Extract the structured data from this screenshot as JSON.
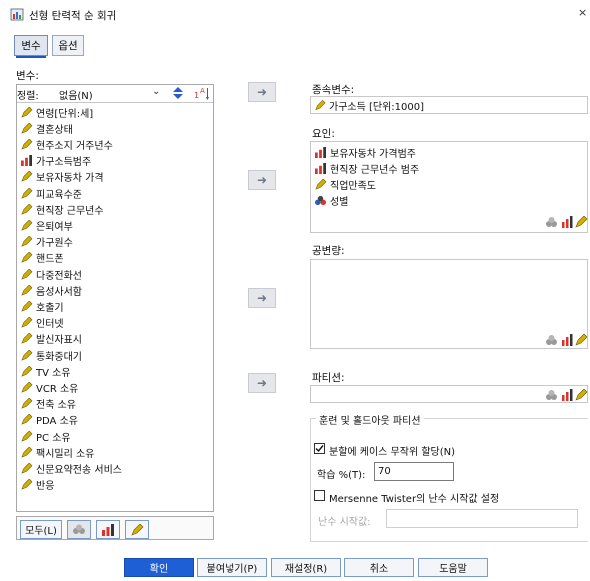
{
  "window": {
    "title": "선형 탄력적 순 회귀"
  },
  "tabs": [
    {
      "label": "변수"
    },
    {
      "label": "옵션"
    }
  ],
  "variables": {
    "label": "변수:",
    "sort": {
      "label": "정렬:",
      "value": "없음(N)"
    },
    "items": [
      {
        "label": "연령[단위:세]",
        "type": "scale"
      },
      {
        "label": "결혼상태",
        "type": "scale"
      },
      {
        "label": "현주소지 거주년수",
        "type": "scale"
      },
      {
        "label": "가구소득범주",
        "type": "ordinal"
      },
      {
        "label": "보유자동차 가격",
        "type": "scale"
      },
      {
        "label": "피교육수준",
        "type": "scale"
      },
      {
        "label": "현직장 근무년수",
        "type": "scale"
      },
      {
        "label": "은퇴여부",
        "type": "scale"
      },
      {
        "label": "가구원수",
        "type": "scale"
      },
      {
        "label": "핸드폰",
        "type": "scale"
      },
      {
        "label": "다중전화선",
        "type": "scale"
      },
      {
        "label": "음성사서함",
        "type": "scale"
      },
      {
        "label": "호출기",
        "type": "scale"
      },
      {
        "label": "인터넷",
        "type": "scale"
      },
      {
        "label": "발신자표시",
        "type": "scale"
      },
      {
        "label": "통화중대기",
        "type": "scale"
      },
      {
        "label": "TV 소유",
        "type": "scale"
      },
      {
        "label": "VCR 소유",
        "type": "scale"
      },
      {
        "label": "전축 소유",
        "type": "scale"
      },
      {
        "label": "PDA 소유",
        "type": "scale"
      },
      {
        "label": "PC 소유",
        "type": "scale"
      },
      {
        "label": "팩시밀리 소유",
        "type": "scale"
      },
      {
        "label": "신문요약전송 서비스",
        "type": "scale"
      },
      {
        "label": "반응",
        "type": "scale"
      }
    ],
    "all_button": "모두(L)"
  },
  "dependent": {
    "label": "종속변수:",
    "value": "가구소득 [단위:1000]"
  },
  "factors": {
    "label": "요인:",
    "items": [
      {
        "label": "보유자동차 가격범주",
        "type": "ordinal"
      },
      {
        "label": "현직장 근무년수 범주",
        "type": "ordinal"
      },
      {
        "label": "직업만족도",
        "type": "scale"
      },
      {
        "label": "성별",
        "type": "nominal"
      }
    ]
  },
  "covariates": {
    "label": "공변량:"
  },
  "partition": {
    "label": "파티션:"
  },
  "training": {
    "group_title": "훈련 및 홀드아웃 파티션",
    "random_assign_label": "분할에 케이스 무작위 할당(N)",
    "random_assign_checked": true,
    "learning_label": "학습 %(T):",
    "learning_value": "70",
    "mersenne_label": "Mersenne Twister의 난수 시작값 설정",
    "mersenne_checked": false,
    "seed_label": "난수 시작값:"
  },
  "buttons": {
    "ok": "확인",
    "paste": "붙여넣기(P)",
    "reset": "재설정(R)",
    "cancel": "취소",
    "help": "도움말"
  },
  "colors": {
    "accent": "#1f5fd6",
    "pencil": "#c8a400",
    "bar_red": "#d9342b"
  }
}
